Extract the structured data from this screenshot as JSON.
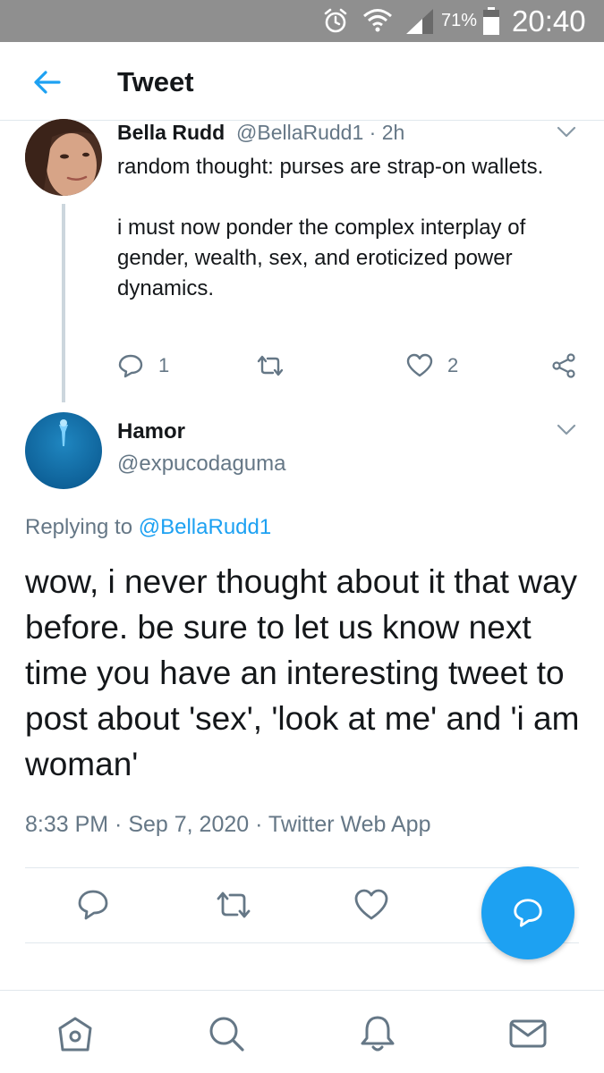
{
  "status_bar": {
    "battery_percent": "71%",
    "time": "20:40",
    "icons": [
      "alarm-icon",
      "wifi-icon",
      "signal-icon",
      "battery-icon"
    ]
  },
  "header": {
    "title": "Tweet",
    "back_icon": "arrow-left-icon"
  },
  "parent_tweet": {
    "name": "Bella Rudd",
    "handle_time": "@BellaRudd1 · 2h",
    "text": "random thought: purses are strap-on wallets.\n\ni must now ponder the complex interplay of gender, wealth, sex, and eroticized power dynamics.",
    "reply_count": "1",
    "like_count": "2"
  },
  "main_tweet": {
    "name": "Hamor",
    "handle": "@expucodaguma",
    "replying_prefix": "Replying to",
    "replying_to": "@BellaRudd1",
    "text": "wow, i never thought about it that way before. be sure to let us know next time you have an interesting tweet to post about 'sex', 'look at me' and 'i am woman'",
    "meta": "8:33 PM · Sep 7, 2020 · Twitter Web App"
  },
  "bottom_nav": [
    "home-icon",
    "search-icon",
    "notifications-icon",
    "messages-icon"
  ],
  "colors": {
    "accent": "#1da1f2",
    "text": "#14171a",
    "secondary_text": "#657786",
    "status_bar": "#8f8f8f",
    "divider": "#e1e8ed"
  }
}
